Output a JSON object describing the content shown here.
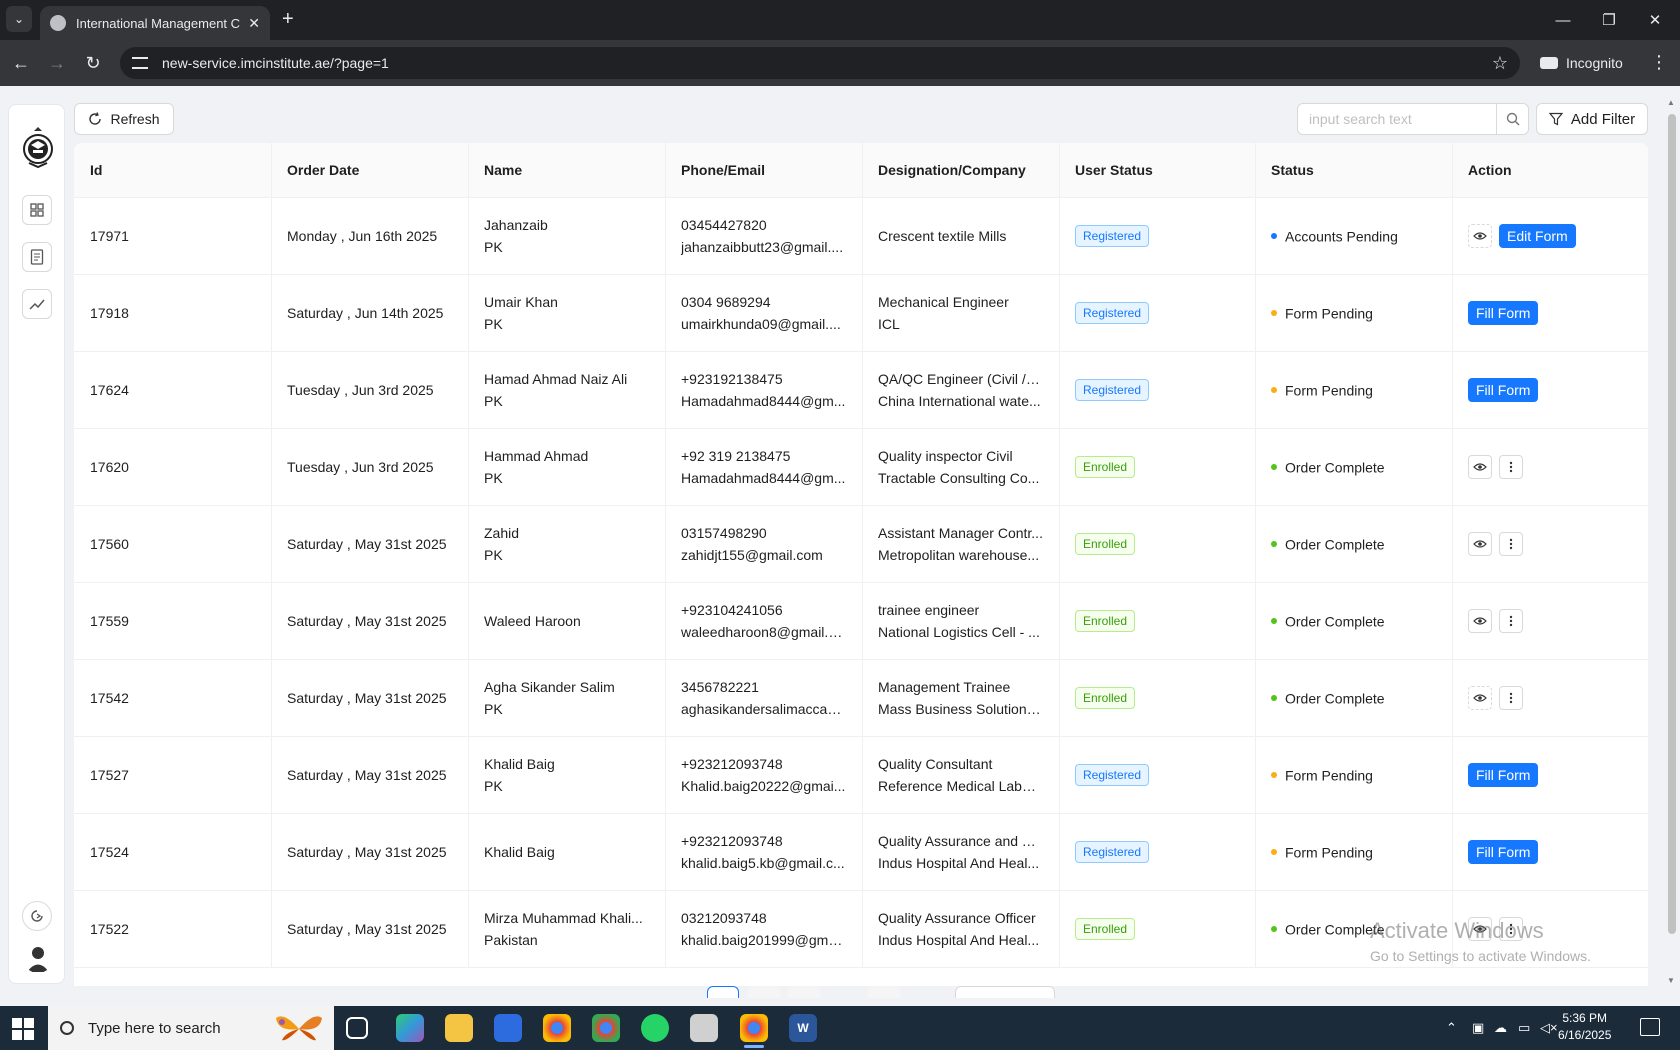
{
  "browser": {
    "tab_title": "International Management Con",
    "url": "new-service.imcinstitute.ae/?page=1",
    "incognito_label": "Incognito"
  },
  "toolbar": {
    "refresh_label": "Refresh",
    "search_placeholder": "input search text",
    "add_filter_label": "Add Filter"
  },
  "table": {
    "headers": [
      "Id",
      "Order Date",
      "Name",
      "Phone/Email",
      "Designation/Company",
      "User Status",
      "Status",
      "Action"
    ],
    "rows": [
      {
        "id": "17971",
        "date": "Monday , Jun 16th 2025",
        "name": "Jahanzaib",
        "country": "PK",
        "phone": "03454427820",
        "email": "jahanzaibbutt23@gmail....",
        "designation": "",
        "company": "Crescent textile Mills",
        "user_status": "Registered",
        "status": "Accounts Pending",
        "action": "view-edit",
        "action_label": "Edit Form"
      },
      {
        "id": "17918",
        "date": "Saturday , Jun 14th 2025",
        "name": "Umair Khan",
        "country": "PK",
        "phone": "0304 9689294",
        "email": "umairkhunda09@gmail....",
        "designation": "Mechanical Engineer",
        "company": "ICL",
        "user_status": "Registered",
        "status": "Form Pending",
        "action": "fill",
        "action_label": "Fill Form"
      },
      {
        "id": "17624",
        "date": "Tuesday , Jun 3rd 2025",
        "name": "Hamad Ahmad Naiz Ali",
        "country": "PK",
        "phone": "+923192138475",
        "email": "Hamadahmad8444@gm...",
        "designation": "QA/QC Engineer (Civil /S...",
        "company": "China International wate...",
        "user_status": "Registered",
        "status": "Form Pending",
        "action": "fill",
        "action_label": "Fill Form"
      },
      {
        "id": "17620",
        "date": "Tuesday , Jun 3rd 2025",
        "name": "Hammad Ahmad",
        "country": "PK",
        "phone": "+92 319 2138475",
        "email": "Hamadahmad8444@gm...",
        "designation": "Quality inspector Civil",
        "company": "Tractable Consulting Co...",
        "user_status": "Enrolled",
        "status": "Order Complete",
        "action": "view-more",
        "action_label": ""
      },
      {
        "id": "17560",
        "date": "Saturday , May 31st 2025",
        "name": "Zahid",
        "country": "PK",
        "phone": "03157498290",
        "email": "zahidjt155@gmail.com",
        "designation": "Assistant Manager Contr...",
        "company": "Metropolitan warehouse...",
        "user_status": "Enrolled",
        "status": "Order Complete",
        "action": "view-more",
        "action_label": ""
      },
      {
        "id": "17559",
        "date": "Saturday , May 31st 2025",
        "name": "Waleed Haroon",
        "country": "",
        "phone": "+923104241056",
        "email": "waleedharoon8@gmail.c...",
        "designation": "trainee engineer",
        "company": "National Logistics Cell - ...",
        "user_status": "Enrolled",
        "status": "Order Complete",
        "action": "view-more",
        "action_label": ""
      },
      {
        "id": "17542",
        "date": "Saturday , May 31st 2025",
        "name": "Agha Sikander Salim",
        "country": "PK",
        "phone": "3456782221",
        "email": "aghasikandersalimacca8...",
        "designation": "Management Trainee",
        "company": "Mass Business Solutions ...",
        "user_status": "Enrolled",
        "status": "Order Complete",
        "action": "view-more-dashed",
        "action_label": ""
      },
      {
        "id": "17527",
        "date": "Saturday , May 31st 2025",
        "name": "Khalid Baig",
        "country": "PK",
        "phone": "+923212093748",
        "email": "Khalid.baig20222@gmai...",
        "designation": "Quality Consultant",
        "company": "Reference Medical Labor...",
        "user_status": "Registered",
        "status": "Form Pending",
        "action": "fill",
        "action_label": "Fill Form"
      },
      {
        "id": "17524",
        "date": "Saturday , May 31st 2025",
        "name": "Khalid Baig",
        "country": "",
        "phone": "+923212093748",
        "email": "khalid.baig5.kb@gmail.c...",
        "designation": "Quality Assurance and Tr...",
        "company": "Indus Hospital And Heal...",
        "user_status": "Registered",
        "status": "Form Pending",
        "action": "fill",
        "action_label": "Fill Form"
      },
      {
        "id": "17522",
        "date": "Saturday , May 31st 2025",
        "name": "Mirza Muhammad Khali...",
        "country": "Pakistan",
        "phone": "03212093748",
        "email": "khalid.baig201999@gma...",
        "designation": "Quality Assurance Officer",
        "company": "Indus Hospital And Heal...",
        "user_status": "Enrolled",
        "status": "Order Complete",
        "action": "view-more",
        "action_label": ""
      }
    ]
  },
  "colors": {
    "primary": "#1677ff",
    "accounts_pending": "#1677ff",
    "form_pending": "#faad14",
    "order_complete": "#52c41a"
  },
  "watermark": {
    "line1": "Activate Windows",
    "line2": "Go to Settings to activate Windows."
  },
  "taskbar": {
    "search_placeholder": "Type here to search",
    "time": "5:36 PM",
    "date": "6/16/2025"
  }
}
